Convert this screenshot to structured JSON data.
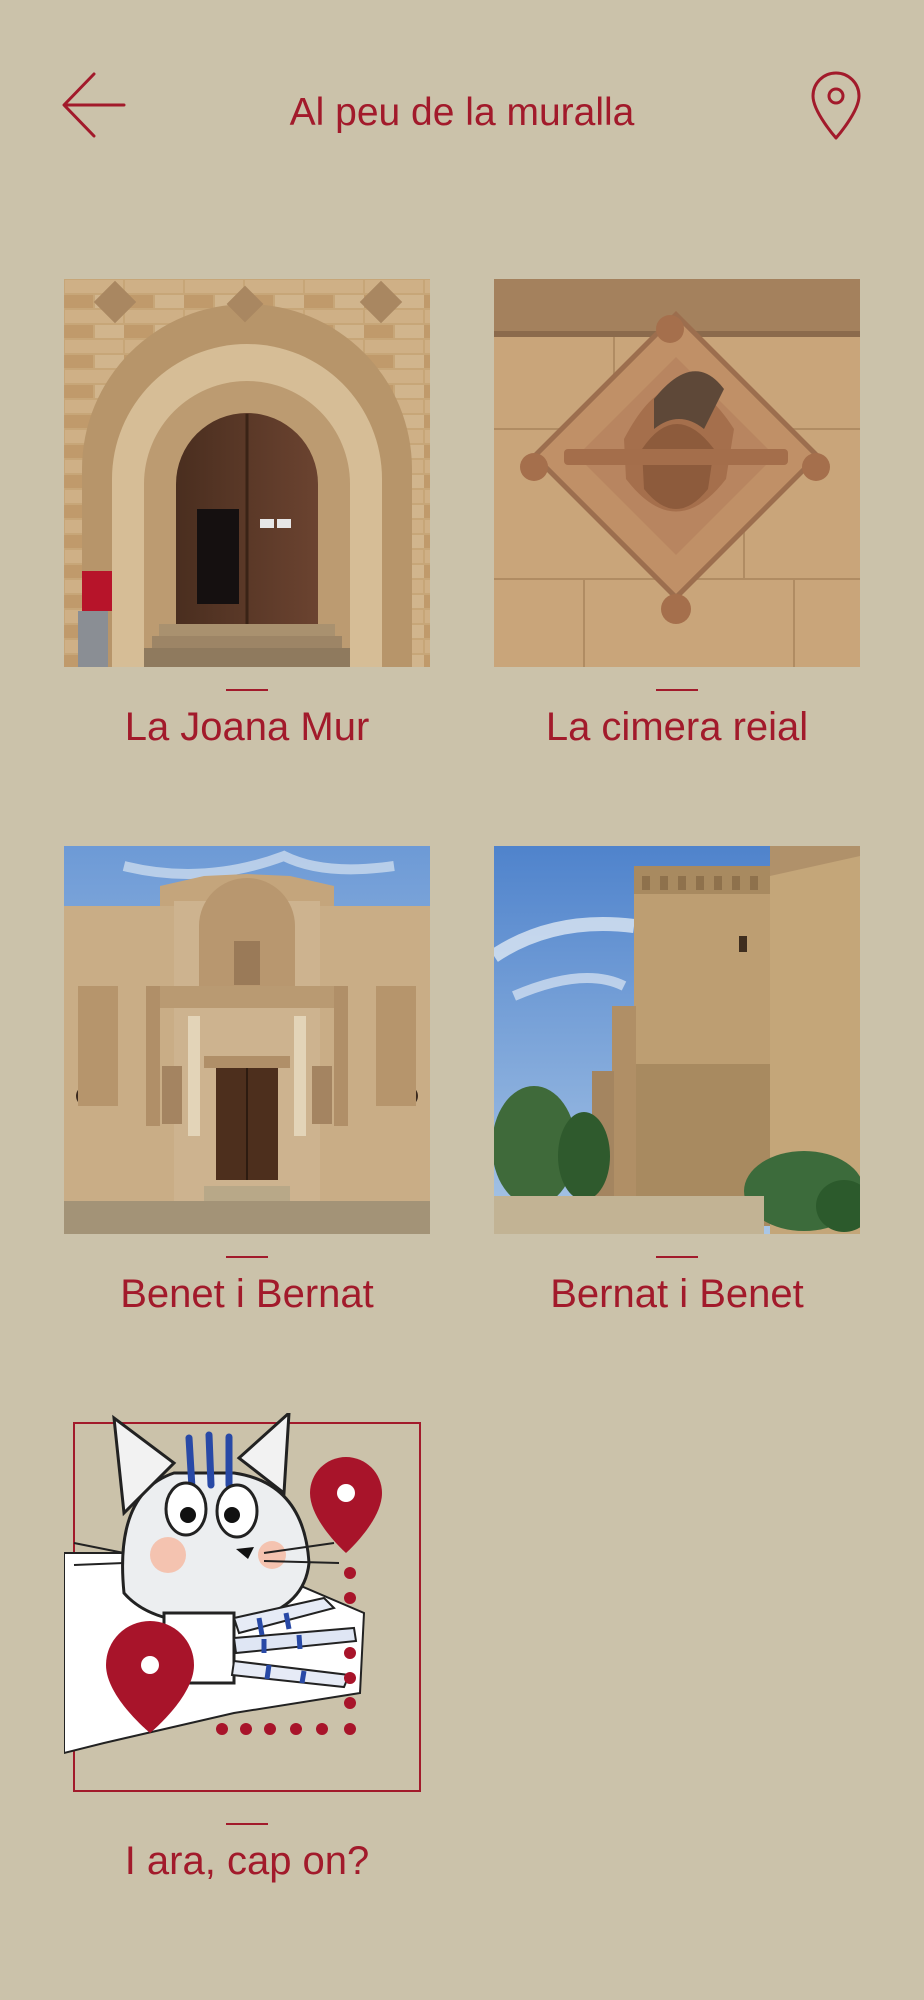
{
  "header": {
    "title": "Al peu de la muralla",
    "back_icon": "arrow-left-icon",
    "map_icon": "map-pin-icon"
  },
  "theme": {
    "background": "#cbc2aa",
    "accent": "#a21a2b"
  },
  "cards": [
    {
      "label": "La Joana Mur",
      "image": "stone arched doorway"
    },
    {
      "label": "La cimera reial",
      "image": "carved coat of arms"
    },
    {
      "label": "Benet i Bernat",
      "image": "baroque church facade"
    },
    {
      "label": "Bernat i Benet",
      "image": "medieval tower wall"
    },
    {
      "label": "I ara, cap on?",
      "image": "cat illustration with map pins"
    }
  ]
}
